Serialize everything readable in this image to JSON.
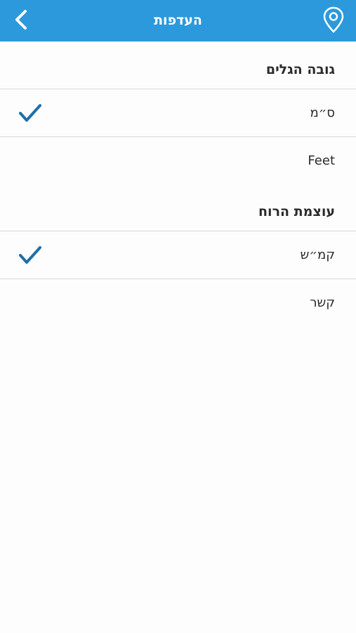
{
  "header": {
    "title": "העדפות",
    "back_icon": "chevron-left-icon",
    "location_icon": "map-pin-icon",
    "bar_color": "#2c99dd"
  },
  "sections": [
    {
      "title": "גובה הגלים",
      "options": [
        {
          "label": "ס״מ",
          "selected": true
        },
        {
          "label": "Feet",
          "selected": false
        }
      ]
    },
    {
      "title": "עוצמת הרוח",
      "options": [
        {
          "label": "קמ״ש",
          "selected": true
        },
        {
          "label": "קשר",
          "selected": false
        }
      ]
    }
  ],
  "check_color": "#1f6fa8"
}
